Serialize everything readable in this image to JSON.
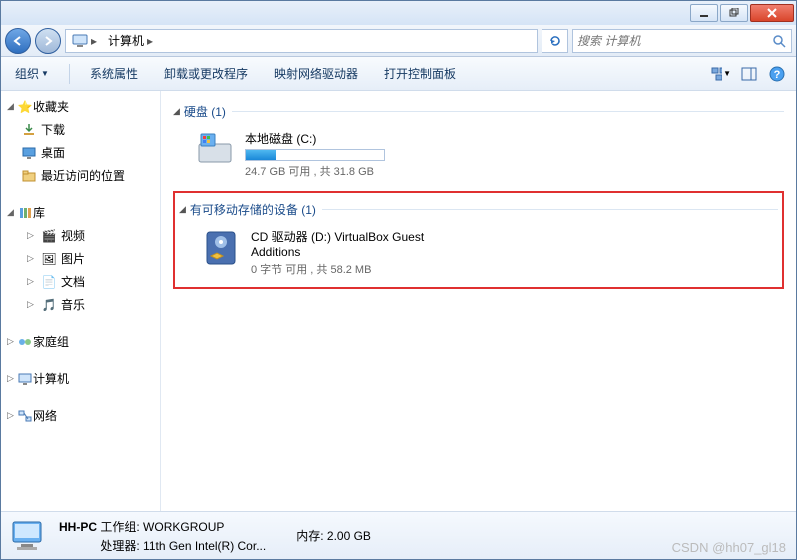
{
  "titlebar": {
    "min": "min",
    "max": "max",
    "close": "close"
  },
  "address": {
    "computer": "计算机"
  },
  "search": {
    "placeholder": "搜索 计算机"
  },
  "toolbar": {
    "organize": "组织",
    "sysprops": "系统属性",
    "uninstall": "卸载或更改程序",
    "mapnet": "映射网络驱动器",
    "controlpanel": "打开控制面板"
  },
  "sidebar": {
    "favorites": "收藏夹",
    "downloads": "下载",
    "desktop": "桌面",
    "recent": "最近访问的位置",
    "libraries": "库",
    "videos": "视频",
    "pictures": "图片",
    "documents": "文档",
    "music": "音乐",
    "homegroup": "家庭组",
    "computer": "计算机",
    "network": "网络"
  },
  "content": {
    "hdd_section": "硬盘 (1)",
    "drive_c": {
      "title": "本地磁盘 (C:)",
      "info": "24.7 GB 可用 , 共 31.8 GB",
      "fill_pct": 22
    },
    "removable_section": "有可移动存储的设备 (1)",
    "cd": {
      "title": "CD 驱动器 (D:) VirtualBox Guest Additions",
      "info": "0 字节 可用 , 共 58.2 MB"
    }
  },
  "statusbar": {
    "computer_name": "HH-PC",
    "workgroup_lbl": "工作组:",
    "workgroup": "WORKGROUP",
    "cpu_lbl": "处理器:",
    "cpu": "11th Gen Intel(R) Cor...",
    "mem_lbl": "内存:",
    "mem": "2.00 GB"
  },
  "watermark": "CSDN @hh07_gl18"
}
